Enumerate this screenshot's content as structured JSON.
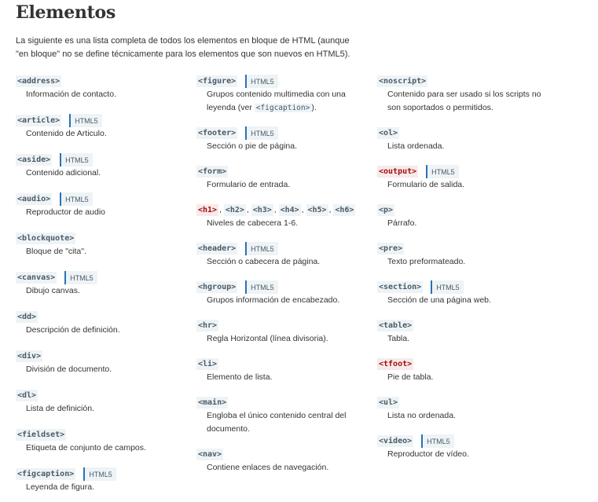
{
  "title": "Elementos",
  "intro": "La siguiente es una lista completa de todos los elementos en bloque de HTML (aunque \"en bloque\" no se define técnicamente para los elementos que son nuevos en HTML5).",
  "badge_text": "HTML5",
  "columns": [
    [
      {
        "tags": [
          "<address>"
        ],
        "desc": "Información de contacto."
      },
      {
        "tags": [
          "<article>"
        ],
        "html5": true,
        "desc": "Contenido de Articulo."
      },
      {
        "tags": [
          "<aside>"
        ],
        "html5": true,
        "desc": "Contenido adicional."
      },
      {
        "tags": [
          "<audio>"
        ],
        "html5": true,
        "desc": "Reproductor de audio"
      },
      {
        "tags": [
          "<blockquote>"
        ],
        "desc": "Bloque de \"cita\"."
      },
      {
        "tags": [
          "<canvas>"
        ],
        "html5": true,
        "desc": "Dibujo canvas."
      },
      {
        "tags": [
          "<dd>"
        ],
        "desc": "Descripción de definición."
      },
      {
        "tags": [
          "<div>"
        ],
        "desc": "División de documento."
      },
      {
        "tags": [
          "<dl>"
        ],
        "desc": "Lista de definición."
      },
      {
        "tags": [
          "<fieldset>"
        ],
        "desc": "Etiqueta de conjunto de campos."
      },
      {
        "tags": [
          "<figcaption>"
        ],
        "html5": true,
        "desc": "Leyenda de figura."
      }
    ],
    [
      {
        "tags": [
          "<figure>"
        ],
        "html5": true,
        "desc_parts": [
          "Grupos contenido multimedia con una leyenda (ver ",
          "<figcaption>",
          ")."
        ]
      },
      {
        "tags": [
          "<footer>"
        ],
        "html5": true,
        "desc": "Sección o pie de página."
      },
      {
        "tags": [
          "<form>"
        ],
        "desc": "Formulario de entrada."
      },
      {
        "tags": [
          "<h1>",
          "<h2>",
          "<h3>",
          "<h4>",
          "<h5>",
          "<h6>"
        ],
        "obsolete_index": [
          0
        ],
        "separator": ",",
        "desc": "Niveles de cabecera 1-6."
      },
      {
        "tags": [
          "<header>"
        ],
        "html5": true,
        "desc": "Sección o cabecera de página."
      },
      {
        "tags": [
          "<hgroup>"
        ],
        "html5": true,
        "desc": "Grupos información de encabezado."
      },
      {
        "tags": [
          "<hr>"
        ],
        "desc": "Regla Horizontal (línea divisoria)."
      },
      {
        "tags": [
          "<li>"
        ],
        "desc": "Elemento de lista."
      },
      {
        "tags": [
          "<main>"
        ],
        "desc": "Engloba el único contenido central del documento."
      },
      {
        "tags": [
          "<nav>"
        ],
        "desc": "Contiene enlaces de navegación."
      }
    ],
    [
      {
        "tags": [
          "<noscript>"
        ],
        "desc": "Contenido para ser usado si los scripts no son soportados o permitidos."
      },
      {
        "tags": [
          "<ol>"
        ],
        "desc": "Lista ordenada."
      },
      {
        "tags": [
          "<output>"
        ],
        "obsolete_index": [
          0
        ],
        "html5": true,
        "desc": "Formulario de salida."
      },
      {
        "tags": [
          "<p>"
        ],
        "desc": "Párrafo."
      },
      {
        "tags": [
          "<pre>"
        ],
        "desc": "Texto preformateado."
      },
      {
        "tags": [
          "<section>"
        ],
        "html5": true,
        "desc": "Sección de una página web."
      },
      {
        "tags": [
          "<table>"
        ],
        "desc": "Tabla."
      },
      {
        "tags": [
          "<tfoot>"
        ],
        "obsolete_index": [
          0
        ],
        "desc": "Pie de tabla."
      },
      {
        "tags": [
          "<ul>"
        ],
        "desc": "Lista no ordenada."
      },
      {
        "tags": [
          "<video>"
        ],
        "html5": true,
        "desc": "Reproductor de vídeo."
      }
    ]
  ],
  "colors": {
    "tag_text": "#4b5a66",
    "tag_bg": "#eef3f6",
    "obsolete_text": "#a01010",
    "badge_border": "#2a72b5"
  }
}
